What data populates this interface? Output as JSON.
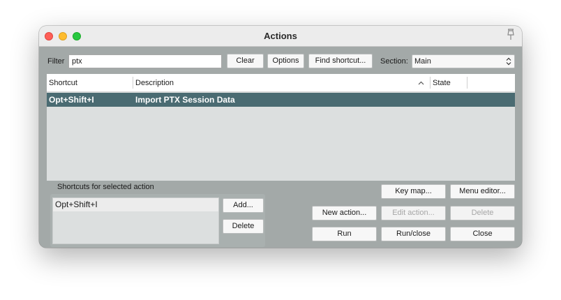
{
  "window": {
    "title": "Actions"
  },
  "filter": {
    "label": "Filter",
    "value": "ptx"
  },
  "toolbar": {
    "clear": "Clear",
    "options": "Options",
    "find_shortcut": "Find shortcut...",
    "section_label": "Section:",
    "section_value": "Main"
  },
  "table": {
    "headers": {
      "shortcut": "Shortcut",
      "description": "Description",
      "state": "State"
    },
    "sort_column": "Description",
    "rows": [
      {
        "shortcut": "Opt+Shift+I",
        "description": "Import PTX Session Data",
        "state": "",
        "selected": true
      }
    ]
  },
  "shortcuts_panel": {
    "label": "Shortcuts for selected action",
    "items": [
      "Opt+Shift+I"
    ],
    "add": "Add...",
    "delete": "Delete"
  },
  "actions": {
    "key_map": "Key map...",
    "menu_editor": "Menu editor...",
    "new_action": "New action...",
    "edit_action": "Edit action...",
    "delete": "Delete",
    "run": "Run",
    "run_close": "Run/close",
    "close": "Close"
  },
  "colors": {
    "window_bg": "#a3a9a8",
    "selection": "#4a6b72",
    "list_bg": "#dcdfdf"
  }
}
